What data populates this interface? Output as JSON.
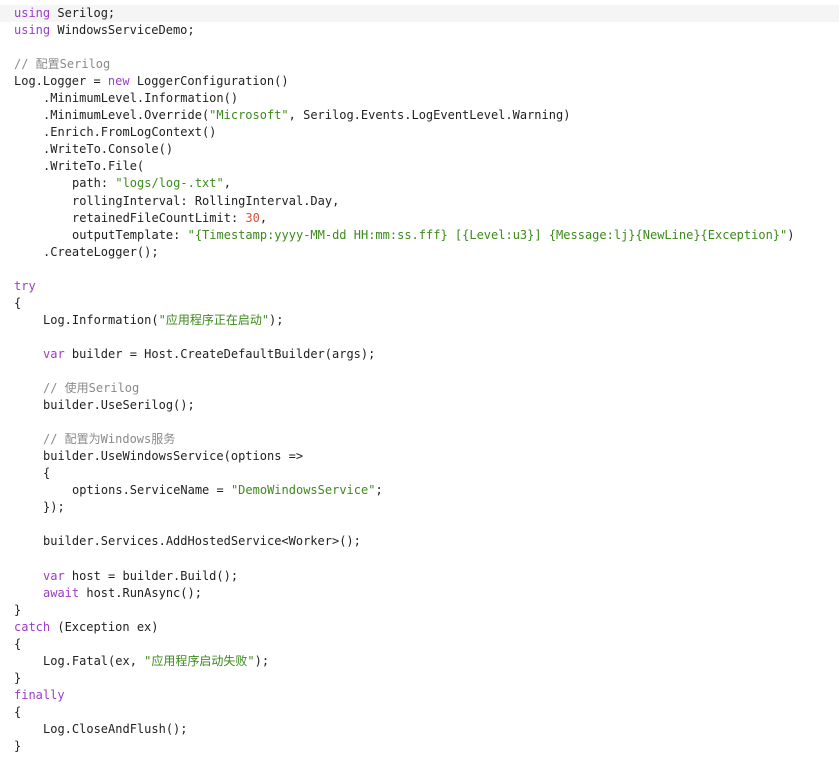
{
  "editor": {
    "current_line": 0,
    "colors": {
      "background": "#ffffff",
      "current_line": "#f5f5f5",
      "plain": "#1f1f1f",
      "keyword": "#9b3dc6",
      "string": "#3d8a1b",
      "number": "#d4553a",
      "comment": "#8a8a8a"
    },
    "lines": [
      {
        "indent": 0,
        "tokens": [
          [
            "keyword",
            "using"
          ],
          [
            "plain",
            " Serilog;"
          ]
        ]
      },
      {
        "indent": 0,
        "tokens": [
          [
            "keyword",
            "using"
          ],
          [
            "plain",
            " WindowsServiceDemo;"
          ]
        ]
      },
      {
        "indent": 0,
        "tokens": []
      },
      {
        "indent": 0,
        "tokens": [
          [
            "comment",
            "// 配置Serilog"
          ]
        ]
      },
      {
        "indent": 0,
        "tokens": [
          [
            "plain",
            "Log.Logger = "
          ],
          [
            "keyword",
            "new"
          ],
          [
            "plain",
            " LoggerConfiguration()"
          ]
        ]
      },
      {
        "indent": 1,
        "tokens": [
          [
            "plain",
            ".MinimumLevel.Information()"
          ]
        ]
      },
      {
        "indent": 1,
        "tokens": [
          [
            "plain",
            ".MinimumLevel.Override("
          ],
          [
            "string",
            "\"Microsoft\""
          ],
          [
            "plain",
            ", Serilog.Events.LogEventLevel.Warning)"
          ]
        ]
      },
      {
        "indent": 1,
        "tokens": [
          [
            "plain",
            ".Enrich.FromLogContext()"
          ]
        ]
      },
      {
        "indent": 1,
        "tokens": [
          [
            "plain",
            ".WriteTo.Console()"
          ]
        ]
      },
      {
        "indent": 1,
        "tokens": [
          [
            "plain",
            ".WriteTo.File("
          ]
        ]
      },
      {
        "indent": 2,
        "tokens": [
          [
            "plain",
            "path: "
          ],
          [
            "string",
            "\"logs/log-.txt\""
          ],
          [
            "plain",
            ","
          ]
        ]
      },
      {
        "indent": 2,
        "tokens": [
          [
            "plain",
            "rollingInterval: RollingInterval.Day,"
          ]
        ]
      },
      {
        "indent": 2,
        "tokens": [
          [
            "plain",
            "retainedFileCountLimit: "
          ],
          [
            "number",
            "30"
          ],
          [
            "plain",
            ","
          ]
        ]
      },
      {
        "indent": 2,
        "tokens": [
          [
            "plain",
            "outputTemplate: "
          ],
          [
            "string",
            "\"{Timestamp:yyyy-MM-dd HH:mm:ss.fff} [{Level:u3}] {Message:lj}{NewLine}{Exception}\""
          ],
          [
            "plain",
            ")"
          ]
        ]
      },
      {
        "indent": 1,
        "tokens": [
          [
            "plain",
            ".CreateLogger();"
          ]
        ]
      },
      {
        "indent": 0,
        "tokens": []
      },
      {
        "indent": 0,
        "tokens": [
          [
            "keyword",
            "try"
          ]
        ]
      },
      {
        "indent": 0,
        "tokens": [
          [
            "plain",
            "{"
          ]
        ]
      },
      {
        "indent": 1,
        "tokens": [
          [
            "plain",
            "Log.Information("
          ],
          [
            "string",
            "\"应用程序正在启动\""
          ],
          [
            "plain",
            ");"
          ]
        ]
      },
      {
        "indent": 0,
        "tokens": []
      },
      {
        "indent": 1,
        "tokens": [
          [
            "keyword",
            "var"
          ],
          [
            "plain",
            " builder = Host.CreateDefaultBuilder(args);"
          ]
        ]
      },
      {
        "indent": 0,
        "tokens": []
      },
      {
        "indent": 1,
        "tokens": [
          [
            "comment",
            "// 使用Serilog"
          ]
        ]
      },
      {
        "indent": 1,
        "tokens": [
          [
            "plain",
            "builder.UseSerilog();"
          ]
        ]
      },
      {
        "indent": 0,
        "tokens": []
      },
      {
        "indent": 1,
        "tokens": [
          [
            "comment",
            "// 配置为Windows服务"
          ]
        ]
      },
      {
        "indent": 1,
        "tokens": [
          [
            "plain",
            "builder.UseWindowsService(options =>"
          ]
        ]
      },
      {
        "indent": 1,
        "tokens": [
          [
            "plain",
            "{"
          ]
        ]
      },
      {
        "indent": 2,
        "tokens": [
          [
            "plain",
            "options.ServiceName = "
          ],
          [
            "string",
            "\"DemoWindowsService\""
          ],
          [
            "plain",
            ";"
          ]
        ]
      },
      {
        "indent": 1,
        "tokens": [
          [
            "plain",
            "});"
          ]
        ]
      },
      {
        "indent": 0,
        "tokens": []
      },
      {
        "indent": 1,
        "tokens": [
          [
            "plain",
            "builder.Services.AddHostedService<Worker>();"
          ]
        ]
      },
      {
        "indent": 0,
        "tokens": []
      },
      {
        "indent": 1,
        "tokens": [
          [
            "keyword",
            "var"
          ],
          [
            "plain",
            " host = builder.Build();"
          ]
        ]
      },
      {
        "indent": 1,
        "tokens": [
          [
            "keyword",
            "await"
          ],
          [
            "plain",
            " host.RunAsync();"
          ]
        ]
      },
      {
        "indent": 0,
        "tokens": [
          [
            "plain",
            "}"
          ]
        ]
      },
      {
        "indent": 0,
        "tokens": [
          [
            "keyword",
            "catch"
          ],
          [
            "plain",
            " (Exception ex)"
          ]
        ]
      },
      {
        "indent": 0,
        "tokens": [
          [
            "plain",
            "{"
          ]
        ]
      },
      {
        "indent": 1,
        "tokens": [
          [
            "plain",
            "Log.Fatal(ex, "
          ],
          [
            "string",
            "\"应用程序启动失败\""
          ],
          [
            "plain",
            ");"
          ]
        ]
      },
      {
        "indent": 0,
        "tokens": [
          [
            "plain",
            "}"
          ]
        ]
      },
      {
        "indent": 0,
        "tokens": [
          [
            "keyword",
            "finally"
          ]
        ]
      },
      {
        "indent": 0,
        "tokens": [
          [
            "plain",
            "{"
          ]
        ]
      },
      {
        "indent": 1,
        "tokens": [
          [
            "plain",
            "Log.CloseAndFlush();"
          ]
        ]
      },
      {
        "indent": 0,
        "tokens": [
          [
            "plain",
            "}"
          ]
        ]
      }
    ]
  }
}
